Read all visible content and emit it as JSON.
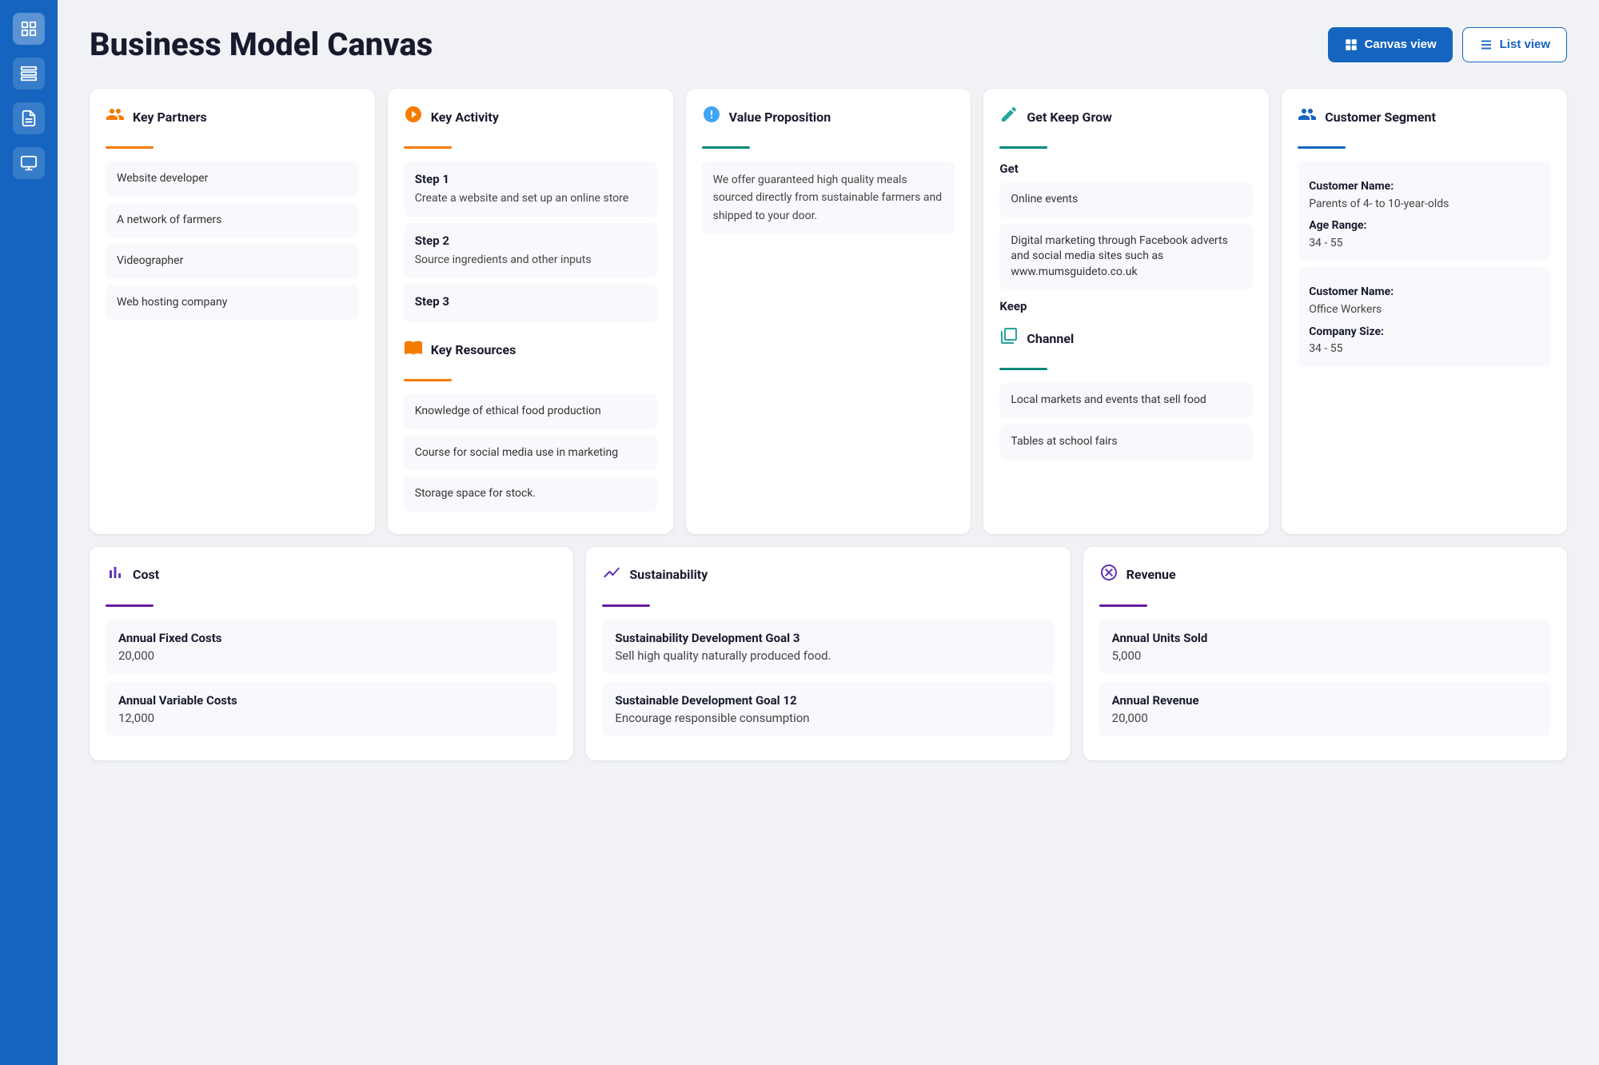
{
  "page": {
    "title": "Business Model Canvas"
  },
  "header": {
    "canvas_view_label": "Canvas view",
    "list_view_label": "List view"
  },
  "sidebar": {
    "icons": [
      "📋",
      "🗃️",
      "📝",
      "🖥️"
    ]
  },
  "key_partners": {
    "title": "Key Partners",
    "items": [
      "Website developer",
      "A network of farmers",
      "Videographer",
      "Web hosting company"
    ]
  },
  "key_activity": {
    "title": "Key Activity",
    "steps": [
      {
        "label": "Step 1",
        "desc": "Create a website and set up an online store"
      },
      {
        "label": "Step 2",
        "desc": "Source ingredients and other inputs"
      },
      {
        "label": "Step 3",
        "desc": ""
      }
    ],
    "resources_title": "Key Resources",
    "resources": [
      "Knowledge of ethical food production",
      "Course for social media use in marketing",
      "Storage space for stock."
    ]
  },
  "value_proposition": {
    "title": "Value Proposition",
    "text": "We offer guaranteed high quality meals sourced directly from sustainable farmers and shipped to your door."
  },
  "get_keep_grow": {
    "title": "Get Keep Grow",
    "get_label": "Get",
    "get_items": [
      "Online events",
      "Digital marketing through Facebook adverts and social media sites such as www.mumsguideto.co.uk"
    ],
    "keep_label": "Keep",
    "channel_title": "Channel",
    "channel_items": [
      "Local markets and events that sell food",
      "Tables at school fairs"
    ]
  },
  "customer_segment": {
    "title": "Customer Segment",
    "customers": [
      {
        "name_label": "Customer Name:",
        "name_value": "Parents of 4- to 10-year-olds",
        "age_label": "Age Range:",
        "age_value": "34 - 55"
      },
      {
        "name_label": "Customer Name:",
        "name_value": "Office Workers",
        "size_label": "Company Size:",
        "size_value": "34 - 55"
      }
    ]
  },
  "cost": {
    "title": "Cost",
    "items": [
      {
        "label": "Annual Fixed Costs",
        "value": "20,000"
      },
      {
        "label": "Annual Variable Costs",
        "value": "12,000"
      }
    ]
  },
  "sustainability": {
    "title": "Sustainability",
    "items": [
      {
        "label": "Sustainability Development Goal 3",
        "value": "Sell high quality naturally produced food."
      },
      {
        "label": "Sustainable Development Goal 12",
        "value": "Encourage responsible consumption"
      }
    ]
  },
  "revenue": {
    "title": "Revenue",
    "items": [
      {
        "label": "Annual Units Sold",
        "value": "5,000"
      },
      {
        "label": "Annual Revenue",
        "value": "20,000"
      }
    ]
  }
}
